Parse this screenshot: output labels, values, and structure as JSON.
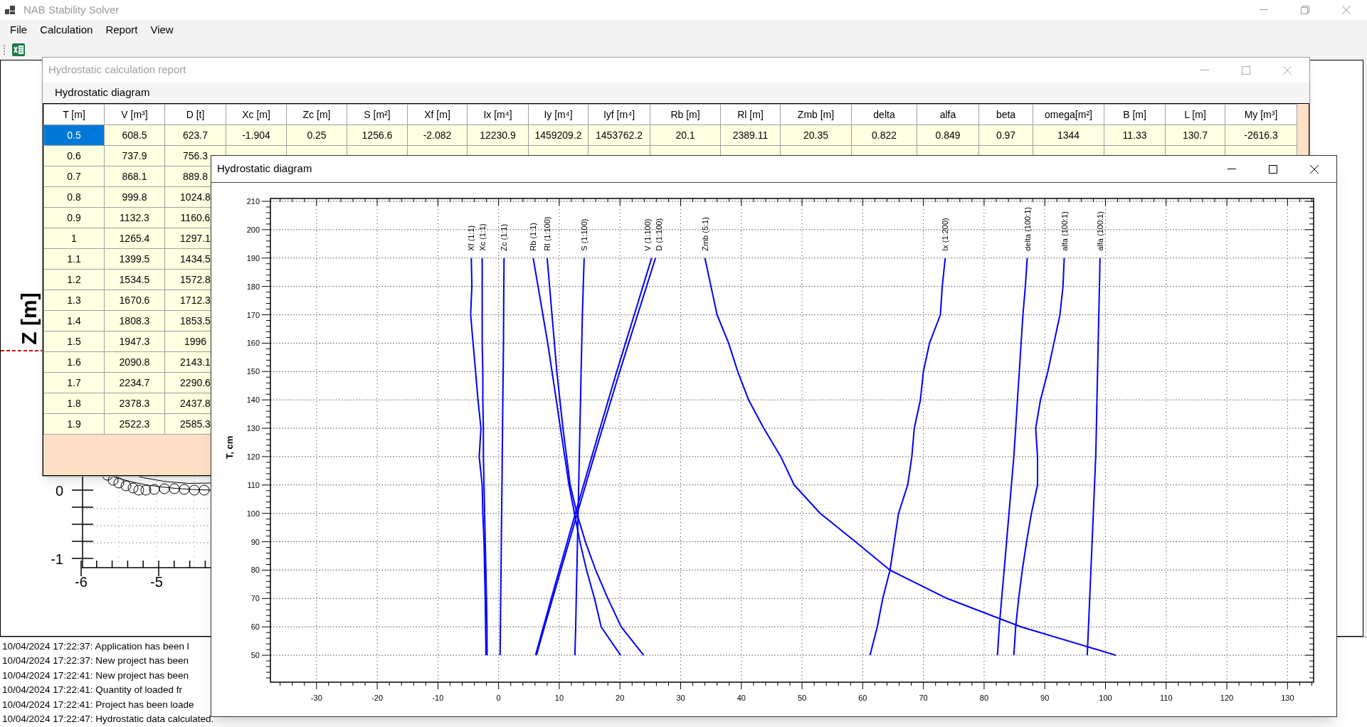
{
  "app": {
    "title": "NAB Stability Solver"
  },
  "menu": [
    "File",
    "Calculation",
    "Report",
    "View"
  ],
  "back_plot": {
    "axis_title": "Z [m]",
    "y_ticks": [
      "0",
      "-1"
    ],
    "x_ticks": [
      "-6",
      "-5"
    ]
  },
  "log": [
    "10/04/2024 17:22:37: Application has been l",
    "10/04/2024 17:22:37: New project has been",
    "10/04/2024 17:22:41: New project has been",
    "10/04/2024 17:22:41: Quantity of loaded fr",
    "10/04/2024 17:22:41: Project has been loade",
    "10/04/2024 17:22:47: Hydrostatic data calculated."
  ],
  "report_window": {
    "title": "Hydrostatic calculation report",
    "tab": "Hydrostatic diagram",
    "columns": [
      "T [m]",
      "V [m³]",
      "D [t]",
      "Xc [m]",
      "Zc [m]",
      "S [m²]",
      "Xf [m]",
      "Ix [m⁴]",
      "Iy [m⁴]",
      "Iyf [m⁴]",
      "Rb [m]",
      "Rl [m]",
      "Zmb [m]",
      "delta",
      "alfa",
      "beta",
      "omega[m²]",
      "B [m]",
      "L [m]",
      "My [m³]"
    ],
    "rows": [
      {
        "selected": true,
        "cells": [
          "0.5",
          "608.5",
          "623.7",
          "-1.904",
          "0.25",
          "1256.6",
          "-2.082",
          "12230.9",
          "1459209.2",
          "1453762.2",
          "20.1",
          "2389.11",
          "20.35",
          "0.822",
          "0.849",
          "0.97",
          "1344",
          "11.33",
          "130.7",
          "-2616.3"
        ]
      },
      {
        "selected": false,
        "cells": [
          "0.6",
          "737.9",
          "756.3"
        ]
      },
      {
        "selected": false,
        "cells": [
          "0.7",
          "868.1",
          "889.8"
        ]
      },
      {
        "selected": false,
        "cells": [
          "0.8",
          "999.8",
          "1024.8"
        ]
      },
      {
        "selected": false,
        "cells": [
          "0.9",
          "1132.3",
          "1160.6"
        ]
      },
      {
        "selected": false,
        "cells": [
          "1",
          "1265.4",
          "1297.1"
        ]
      },
      {
        "selected": false,
        "cells": [
          "1.1",
          "1399.5",
          "1434.5"
        ]
      },
      {
        "selected": false,
        "cells": [
          "1.2",
          "1534.5",
          "1572.8"
        ]
      },
      {
        "selected": false,
        "cells": [
          "1.3",
          "1670.6",
          "1712.3"
        ]
      },
      {
        "selected": false,
        "cells": [
          "1.4",
          "1808.3",
          "1853.5"
        ]
      },
      {
        "selected": false,
        "cells": [
          "1.5",
          "1947.3",
          "1996"
        ]
      },
      {
        "selected": false,
        "cells": [
          "1.6",
          "2090.8",
          "2143.1"
        ]
      },
      {
        "selected": false,
        "cells": [
          "1.7",
          "2234.7",
          "2290.6"
        ]
      },
      {
        "selected": false,
        "cells": [
          "1.8",
          "2378.3",
          "2437.8"
        ]
      },
      {
        "selected": false,
        "cells": [
          "1.9",
          "2522.3",
          "2585.3"
        ]
      }
    ]
  },
  "diagram_window": {
    "title": "Hydrostatic diagram",
    "chart_data": {
      "type": "line",
      "orientation": "horizontal",
      "grid": true,
      "ylabel": "T, cm",
      "x": [
        50,
        60,
        70,
        80,
        90,
        100,
        110,
        120,
        130,
        140,
        150,
        160,
        170,
        180,
        190
      ],
      "xlim": [
        -37.6,
        134.3
      ],
      "ylim": [
        40.5,
        211
      ],
      "yticks": [
        50,
        60,
        70,
        80,
        90,
        100,
        110,
        120,
        130,
        140,
        150,
        160,
        170,
        180,
        190,
        200,
        210
      ],
      "xticks": [
        -30,
        -20,
        -10,
        0,
        10,
        20,
        30,
        40,
        50,
        60,
        70,
        80,
        90,
        100,
        110,
        120,
        130
      ],
      "series": [
        {
          "name": "Xf (1:1)",
          "color": "#0000ff",
          "values": [
            -2.08,
            -2.14,
            -2.2,
            -2.3,
            -2.4,
            -2.6,
            -2.7,
            -3.2,
            -2.9,
            -3.4,
            -3.8,
            -4.2,
            -4.6,
            -4.4,
            -4.5
          ]
        },
        {
          "name": "Xc (1:1)",
          "color": "#0000ff",
          "values": [
            -1.9,
            -1.92,
            -2.0,
            -2.1,
            -2.2,
            -2.3,
            -2.4,
            -2.5,
            -2.5,
            -2.6,
            -2.6,
            -2.7,
            -2.7,
            -2.7,
            -2.7
          ]
        },
        {
          "name": "Zc (1:1)",
          "color": "#0000ff",
          "values": [
            0.25,
            0.3,
            0.35,
            0.4,
            0.45,
            0.5,
            0.55,
            0.6,
            0.65,
            0.7,
            0.75,
            0.8,
            0.83,
            0.86,
            0.9
          ]
        },
        {
          "name": "Rb (1:1)",
          "color": "#0000ff",
          "values": [
            20.1,
            16.9,
            15.8,
            14.5,
            13.4,
            12.5,
            11.6,
            10.9,
            10.2,
            9.5,
            8.8,
            8.1,
            7.3,
            6.5,
            5.7
          ]
        },
        {
          "name": "Rl (1:100)",
          "color": "#0000ff",
          "values": [
            23.9,
            20.2,
            18,
            16,
            14.3,
            12.9,
            11.8,
            11.2,
            10.6,
            10.1,
            9.6,
            9.2,
            8.8,
            8.4,
            8.0
          ]
        },
        {
          "name": "S (1:100)",
          "color": "#0000ff",
          "values": [
            12.57,
            12.7,
            12.8,
            12.9,
            13.0,
            13.1,
            13.2,
            13.3,
            13.4,
            13.5,
            13.6,
            13.7,
            13.8,
            13.95,
            14.1
          ]
        },
        {
          "name": "V (1:100)",
          "color": "#0000ff",
          "values": [
            6.09,
            7.38,
            8.68,
            10.0,
            11.32,
            12.65,
            14.0,
            15.35,
            16.71,
            18.08,
            19.47,
            20.91,
            22.35,
            23.78,
            25.22
          ]
        },
        {
          "name": "D (1:100)",
          "color": "#0000ff",
          "values": [
            6.24,
            7.56,
            8.9,
            10.25,
            11.61,
            12.97,
            14.35,
            15.73,
            17.12,
            18.54,
            19.96,
            21.43,
            22.91,
            24.38,
            25.85
          ]
        },
        {
          "name": "Zmb (5:1)",
          "color": "#0000ff",
          "values": [
            101.7,
            86.1,
            73.9,
            64.5,
            58.8,
            53,
            48.7,
            46.5,
            43.7,
            41.2,
            39.4,
            37.9,
            36,
            35,
            34
          ]
        },
        {
          "name": "Ix (1:200)",
          "color": "#0000ff",
          "values": [
            61.2,
            62.4,
            63.3,
            64.5,
            65.2,
            65.9,
            67.4,
            68.1,
            68.5,
            69.5,
            70,
            71,
            72.8,
            73.1,
            73.6
          ]
        },
        {
          "name": "delta (100:1)",
          "color": "#0000ff",
          "values": [
            82.2,
            82.5,
            82.9,
            83.3,
            83.7,
            84.1,
            84.5,
            84.9,
            85.2,
            85.5,
            85.8,
            86.1,
            86.4,
            86.8,
            87.1
          ]
        },
        {
          "name": "alfa (100:1)",
          "color": "#0000ff",
          "values": [
            84.9,
            85.2,
            85.7,
            86.3,
            87.0,
            87.8,
            88.8,
            88.8,
            88.5,
            89.3,
            90.5,
            91.5,
            92.5,
            93.0,
            93.2
          ]
        },
        {
          "name": "alfa (100:1)",
          "color": "#0000ff",
          "values": [
            97,
            97.2,
            97.4,
            97.6,
            97.8,
            98,
            98.2,
            98.4,
            98.5,
            98.6,
            98.7,
            98.8,
            98.9,
            99.0,
            99.1
          ]
        }
      ]
    }
  }
}
